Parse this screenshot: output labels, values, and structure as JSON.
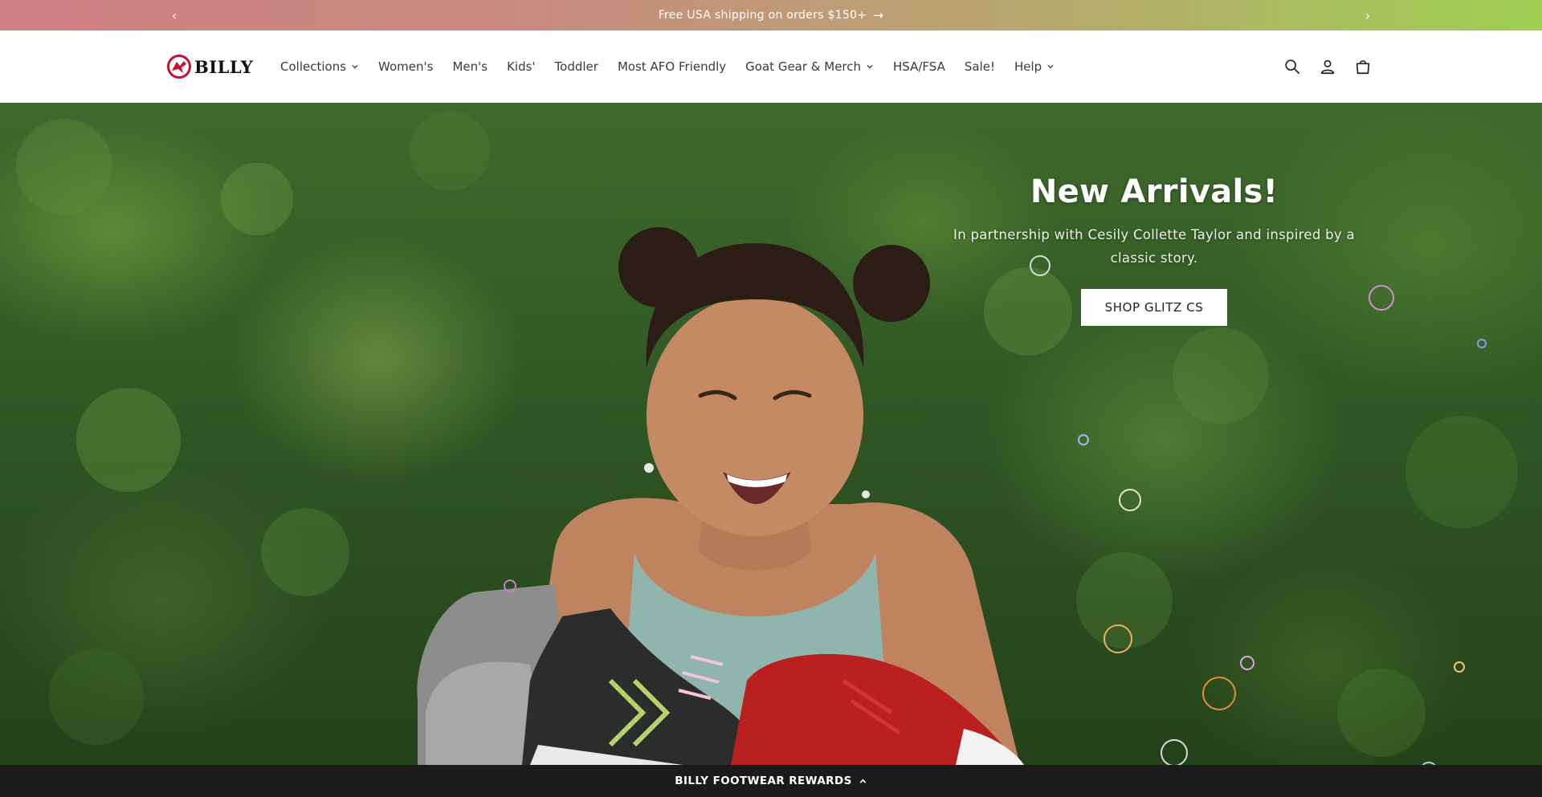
{
  "announcement": {
    "text": "Free USA shipping on orders $150+",
    "prev_icon": "‹",
    "next_icon": "›",
    "arrow_icon": "→"
  },
  "brand": {
    "name": "BILLY",
    "accent_color": "#c8102e"
  },
  "nav": {
    "items": [
      {
        "label": "Collections",
        "has_dropdown": true
      },
      {
        "label": "Women's",
        "has_dropdown": false
      },
      {
        "label": "Men's",
        "has_dropdown": false
      },
      {
        "label": "Kids'",
        "has_dropdown": false
      },
      {
        "label": "Toddler",
        "has_dropdown": false
      },
      {
        "label": "Most AFO Friendly",
        "has_dropdown": false
      },
      {
        "label": "Goat Gear & Merch",
        "has_dropdown": true
      },
      {
        "label": "HSA/FSA",
        "has_dropdown": false
      },
      {
        "label": "Sale!",
        "has_dropdown": false
      },
      {
        "label": "Help",
        "has_dropdown": true
      }
    ]
  },
  "header_icons": [
    "search-icon",
    "account-icon",
    "cart-icon"
  ],
  "hero": {
    "title": "New Arrivals!",
    "subtitle": "In partnership with Cesily Collette Taylor and inspired by a classic story.",
    "button_label": "SHOP GLITZ CS"
  },
  "rewards": {
    "label": "BILLY FOOTWEAR REWARDS"
  }
}
